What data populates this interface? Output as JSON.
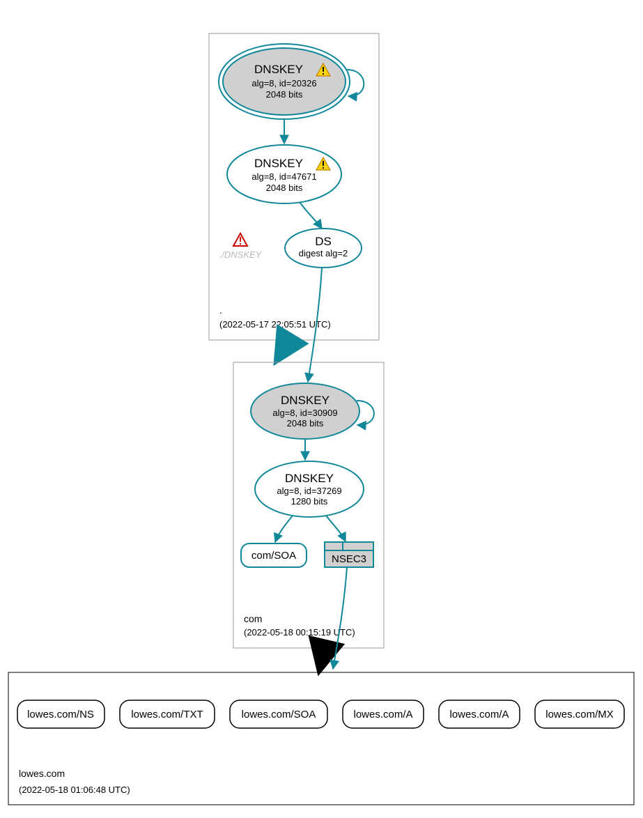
{
  "zones": {
    "root": {
      "label": ".",
      "timestamp": "(2022-05-17 22:05:51 UTC)",
      "ksk": {
        "title": "DNSKEY",
        "line1": "alg=8, id=20326",
        "line2": "2048 bits",
        "warning": true
      },
      "zsk": {
        "title": "DNSKEY",
        "line1": "alg=8, id=47671",
        "line2": "2048 bits",
        "warning": true
      },
      "ghost_dnskey": "./DNSKEY",
      "ds": {
        "title": "DS",
        "line1": "digest alg=2"
      }
    },
    "com": {
      "label": "com",
      "timestamp": "(2022-05-18 00:15:19 UTC)",
      "ksk": {
        "title": "DNSKEY",
        "line1": "alg=8, id=30909",
        "line2": "2048 bits"
      },
      "zsk": {
        "title": "DNSKEY",
        "line1": "alg=8, id=37269",
        "line2": "1280 bits"
      },
      "soa": "com/SOA",
      "nsec3": "NSEC3"
    },
    "lowes": {
      "label": "lowes.com",
      "timestamp": "(2022-05-18 01:06:48 UTC)",
      "records": [
        "lowes.com/NS",
        "lowes.com/TXT",
        "lowes.com/SOA",
        "lowes.com/A",
        "lowes.com/A",
        "lowes.com/MX"
      ]
    }
  }
}
